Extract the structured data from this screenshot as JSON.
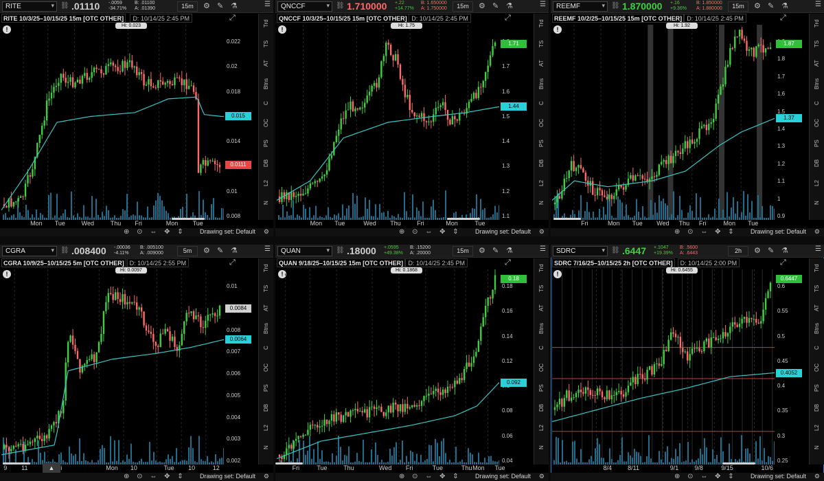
{
  "theme": {
    "up": "#3fcf3f",
    "down": "#ff6a6a",
    "avg": "#37c7c7",
    "vol": "#1f6e8e"
  },
  "side_tabs": [
    "Trd",
    "TS",
    "AT",
    "Btns",
    "C",
    "OC",
    "PS",
    "DB",
    "L2",
    "N"
  ],
  "footer": {
    "drawing_set": "Drawing set: Default",
    "tool_icons": "⊕ ⊙ ⇔ ✥ ⇕"
  },
  "panels": [
    {
      "symbol": "RITE",
      "last": ".01110",
      "last_color": "#cfcfcf",
      "change": "-.0059",
      "change_pct": "-34.71%",
      "change_color": "#cfcfcf",
      "bid": "B: .01100",
      "ask": "A: .01390",
      "bidask_color": "#cfcfcf",
      "timeframe": "15m",
      "title": "RITE 10/3/25–10/15/25 15m [OTC OTHER]",
      "d_info": "D: 10/14/25 2:45 PM",
      "hi_label": "Hi: 0.023",
      "y_ticks": [
        "0.022",
        "0.02",
        "0.018",
        "0.016",
        "0.014",
        "0.012",
        "0.01",
        "0.008"
      ],
      "price_last": "0.0111",
      "price_avg": "0.015",
      "x_ticks": [
        "Mon",
        "Tue",
        "Wed",
        "Thu",
        "Fri",
        "Mon",
        "Tue"
      ]
    },
    {
      "symbol": "QNCCF",
      "last": "1.710000",
      "last_color": "#ff6a6a",
      "change": "+.22",
      "change_pct": "+14.77%",
      "change_color": "#3fcf3f",
      "bid": "B: 1.650000",
      "ask": "A: 1.750000",
      "bidask_color": "#ff6a6a",
      "timeframe": "15m",
      "title": "QNCCF 10/3/25–10/15/25 15m [OTC OTHER]",
      "d_info": "D: 10/14/25 2:45 PM",
      "hi_label": "Hi: 1.75",
      "y_ticks": [
        "1.8",
        "1.7",
        "1.6",
        "1.5",
        "1.4",
        "1.3",
        "1.2",
        "1.1"
      ],
      "price_last": "1.71",
      "price_avg": "1.44",
      "x_ticks": [
        "Mon",
        "Tue",
        "Wed",
        "Thu",
        "Fri",
        "Mon",
        "Tue"
      ]
    },
    {
      "symbol": "REEMF",
      "last": "1.870000",
      "last_color": "#3fcf3f",
      "change": "+.16",
      "change_pct": "+9.36%",
      "change_color": "#3fcf3f",
      "bid": "B: 1.850000",
      "ask": "A: 1.880000",
      "bidask_color": "#ff6a6a",
      "timeframe": "15m",
      "title": "REEMF 10/2/25–10/15/25 15m [OTC OTHER]",
      "d_info": "D: 10/14/25 2:45 PM",
      "hi_label": "Hi: 1.92",
      "y_ticks": [
        "1.9",
        "1.8",
        "1.7",
        "1.6",
        "1.5",
        "1.4",
        "1.3",
        "1.2",
        "1.1",
        "1",
        "0.9"
      ],
      "price_last": "1.87",
      "price_avg": "1.37",
      "x_ticks": [
        "Fri",
        "Mon",
        "Tue",
        "Wed",
        "Thu",
        "Fri",
        "Mon",
        "Tue"
      ]
    },
    {
      "symbol": "CGRA",
      "last": ".008400",
      "last_color": "#cfcfcf",
      "change": "-.00036",
      "change_pct": "-4.11%",
      "change_color": "#cfcfcf",
      "bid": "B: .005100",
      "ask": "A: .009000",
      "bidask_color": "#cfcfcf",
      "timeframe": "5m",
      "title": "CGRA 10/9/25–10/15/25 5m [OTC OTHER]",
      "d_info": "D: 10/14/25 2:55 PM",
      "hi_label": "Hi: 0.0097",
      "y_ticks": [
        "0.01",
        "0.009",
        "0.008",
        "0.007",
        "0.006",
        "0.005",
        "0.004",
        "0.003",
        "0.002"
      ],
      "price_last": "0.0084",
      "price_avg": "0.0064",
      "x_ticks": [
        "9",
        "11",
        "Fri",
        "Mon",
        "10",
        "Tue",
        "10",
        "12"
      ]
    },
    {
      "symbol": "QUAN",
      "last": ".18000",
      "last_color": "#cfcfcf",
      "change": "+.0595",
      "change_pct": "+49.38%",
      "change_color": "#3fcf3f",
      "bid": "B: .15200",
      "ask": "A: .20000",
      "bidask_color": "#cfcfcf",
      "timeframe": "15m",
      "title": "QUAN 9/18/25–10/15/25 15m [OTC OTHER]",
      "d_info": "D: 10/14/25 2:45 PM",
      "hi_label": "Hi: 0.1868",
      "y_ticks": [
        "0.18",
        "0.16",
        "0.14",
        "0.12",
        "0.1",
        "0.08",
        "0.06",
        "0.04"
      ],
      "price_last": "0.18",
      "price_avg": "0.092",
      "x_ticks": [
        "Fri",
        "Tue",
        "Thu",
        "Wed",
        "Fri",
        "Tue",
        "Thu",
        "Mon",
        "Tue"
      ]
    },
    {
      "symbol": "SDRC",
      "last": ".6447",
      "last_color": "#3fcf3f",
      "change": "+.1047",
      "change_pct": "+19.39%",
      "change_color": "#3fcf3f",
      "bid": "B: .5600",
      "ask": "A: .6443",
      "bidask_color": "#ff6a6a",
      "timeframe": "2h",
      "title": "SDRC 7/16/25–10/15/25 2h [OTC OTHER]",
      "d_info": "D: 10/14/25 2:00 PM",
      "hi_label": "Hi: 0.6455",
      "y_ticks": [
        "0.6",
        "0.55",
        "0.5",
        "0.45",
        "0.4",
        "0.35",
        "0.3",
        "0.25"
      ],
      "price_last": "0.6447",
      "price_avg": "0.4052",
      "x_ticks": [
        "8/4",
        "8/11",
        "9/1",
        "9/8",
        "9/15",
        "10/6"
      ]
    }
  ]
}
